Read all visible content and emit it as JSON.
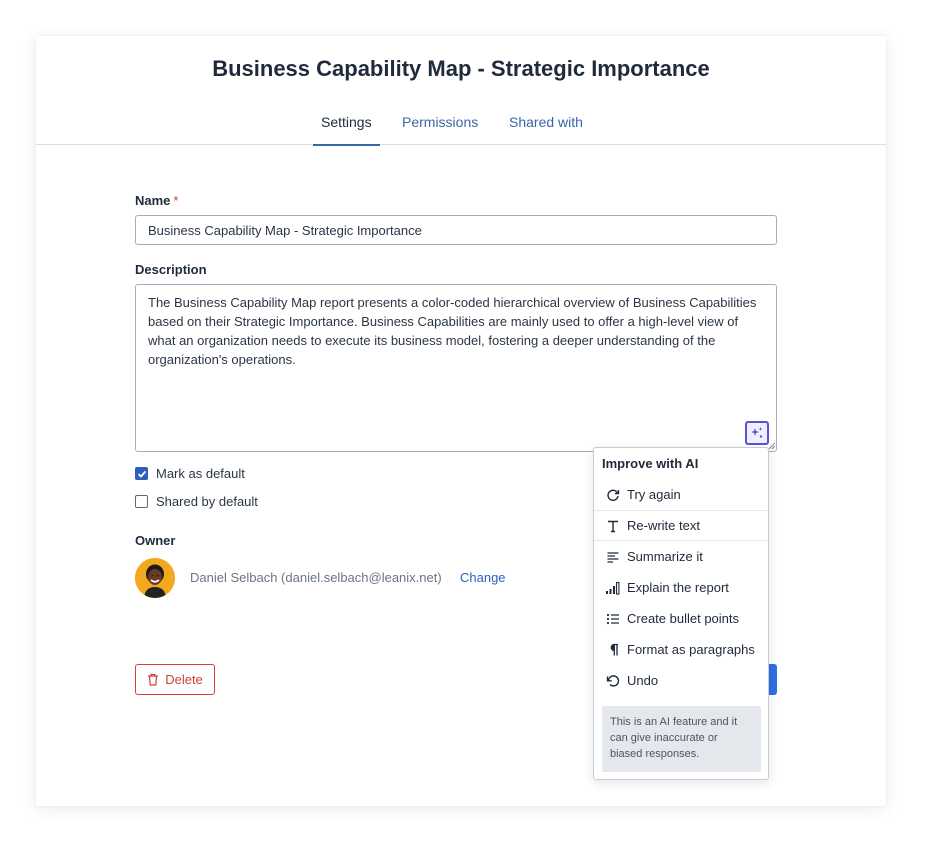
{
  "dialog": {
    "title": "Business Capability Map - Strategic Importance",
    "tabs": [
      {
        "label": "Settings"
      },
      {
        "label": "Permissions"
      },
      {
        "label": "Shared with"
      }
    ]
  },
  "form": {
    "name_label": "Name",
    "required_mark": "*",
    "name_value": "Business Capability Map - Strategic Importance",
    "description_label": "Description",
    "description_value": "The Business Capability Map report presents a color-coded hierarchical overview of Business Capabilities based on their Strategic Importance. Business Capabilities are mainly used to offer a high-level view of what an organization needs to execute its business model, fostering a deeper understanding of the organization's operations.",
    "mark_default_label": "Mark as default",
    "mark_default_checked": true,
    "shared_default_label": "Shared by default",
    "shared_default_checked": false,
    "owner_label": "Owner",
    "owner_name": "Daniel Selbach (daniel.selbach@leanix.net)",
    "change_label": "Change",
    "delete_label": "Delete"
  },
  "ai_menu": {
    "title": "Improve with AI",
    "items": [
      {
        "label": "Try again",
        "icon": "refresh-icon"
      },
      {
        "label": "Re-write text",
        "icon": "text-icon"
      },
      {
        "label": "Summarize it",
        "icon": "summary-lines-icon"
      },
      {
        "label": "Explain the report",
        "icon": "bar-chart-icon"
      },
      {
        "label": "Create bullet points",
        "icon": "bullet-list-icon"
      },
      {
        "label": "Format as paragraphs",
        "icon": "pilcrow-icon"
      },
      {
        "label": "Undo",
        "icon": "undo-icon"
      }
    ],
    "disclaimer": "This is an AI feature and it can give inaccurate or biased responses."
  },
  "colors": {
    "accent": "#2d5fbf",
    "ai_accent": "#5d4fd8",
    "danger": "#d0413b",
    "avatar_bg": "#f3a91e"
  }
}
